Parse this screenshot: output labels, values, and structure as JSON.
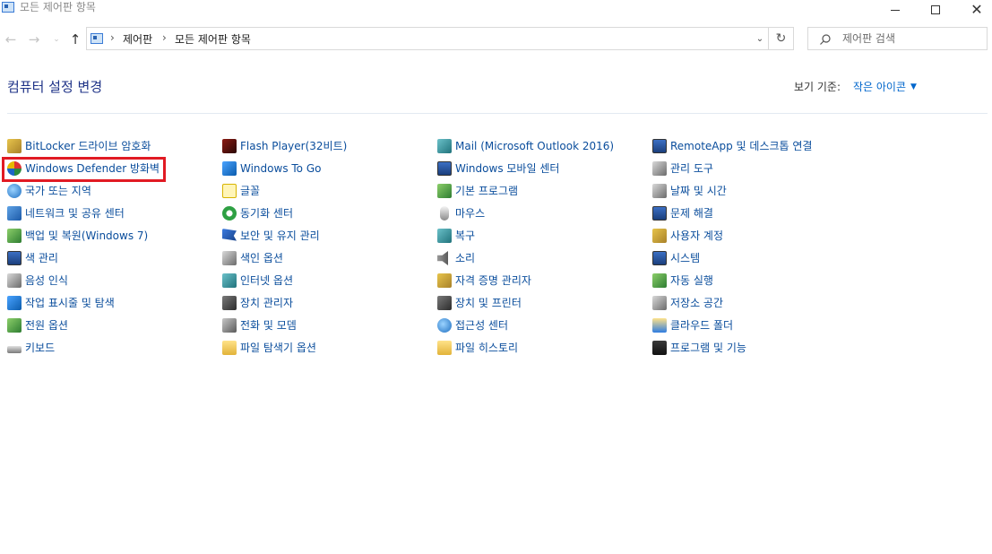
{
  "window": {
    "title": "모든 제어판 항목",
    "minimize_icon": "minimize-icon",
    "maximize_icon": "maximize-icon",
    "close_icon": "close-icon"
  },
  "navigation": {
    "back": "←",
    "forward": "→",
    "recent": "⌄",
    "up": "↑",
    "breadcrumb": [
      "제어판",
      "모든 제어판 항목"
    ],
    "separator": "›",
    "dropdown": "⌄",
    "refresh": "↻"
  },
  "search": {
    "placeholder": "제어판 검색"
  },
  "header": {
    "title": "컴퓨터 설정 변경",
    "view_by_label": "보기 기준:",
    "view_by_value": "작은 아이콘",
    "view_by_arrow": "▼"
  },
  "colors": {
    "title_color": "#1e3287",
    "link_color": "#0a4d9c",
    "accent": "#0066cc",
    "highlight_border": "#e11a23"
  },
  "items": {
    "col1": [
      {
        "label": "BitLocker 드라이브 암호화",
        "icon": "bitlocker-icon"
      },
      {
        "label": "Windows Defender 방화벽",
        "icon": "firewall-icon",
        "highlighted": true
      },
      {
        "label": "국가 또는 지역",
        "icon": "region-icon"
      },
      {
        "label": "네트워크 및 공유 센터",
        "icon": "network-icon"
      },
      {
        "label": "백업 및 복원(Windows 7)",
        "icon": "backup-icon"
      },
      {
        "label": "색 관리",
        "icon": "color-management-icon"
      },
      {
        "label": "음성 인식",
        "icon": "speech-icon"
      },
      {
        "label": "작업 표시줄 및 탐색",
        "icon": "taskbar-icon"
      },
      {
        "label": "전원 옵션",
        "icon": "power-icon"
      },
      {
        "label": "키보드",
        "icon": "keyboard-icon"
      }
    ],
    "col2": [
      {
        "label": "Flash Player(32비트)",
        "icon": "flash-icon"
      },
      {
        "label": "Windows To Go",
        "icon": "windows-to-go-icon"
      },
      {
        "label": "글꼴",
        "icon": "font-icon"
      },
      {
        "label": "동기화 센터",
        "icon": "sync-icon"
      },
      {
        "label": "보안 및 유지 관리",
        "icon": "flag-icon"
      },
      {
        "label": "색인 옵션",
        "icon": "indexing-icon"
      },
      {
        "label": "인터넷 옵션",
        "icon": "internet-options-icon"
      },
      {
        "label": "장치 관리자",
        "icon": "device-manager-icon"
      },
      {
        "label": "전화 및 모뎀",
        "icon": "phone-modem-icon"
      },
      {
        "label": "파일 탐색기 옵션",
        "icon": "folder-options-icon"
      }
    ],
    "col3": [
      {
        "label": "Mail (Microsoft Outlook 2016)",
        "icon": "mail-icon"
      },
      {
        "label": "Windows 모바일 센터",
        "icon": "mobility-icon"
      },
      {
        "label": "기본 프로그램",
        "icon": "default-programs-icon"
      },
      {
        "label": "마우스",
        "icon": "mouse-icon"
      },
      {
        "label": "복구",
        "icon": "recovery-icon"
      },
      {
        "label": "소리",
        "icon": "speaker-icon"
      },
      {
        "label": "자격 증명 관리자",
        "icon": "credential-icon"
      },
      {
        "label": "장치 및 프린터",
        "icon": "printer-icon"
      },
      {
        "label": "접근성 센터",
        "icon": "accessibility-icon"
      },
      {
        "label": "파일 히스토리",
        "icon": "file-history-icon"
      }
    ],
    "col4": [
      {
        "label": "RemoteApp 및 데스크톱 연결",
        "icon": "remoteapp-icon"
      },
      {
        "label": "관리 도구",
        "icon": "admin-tools-icon"
      },
      {
        "label": "날짜 및 시간",
        "icon": "clock-icon"
      },
      {
        "label": "문제 해결",
        "icon": "troubleshoot-icon"
      },
      {
        "label": "사용자 계정",
        "icon": "user-accounts-icon"
      },
      {
        "label": "시스템",
        "icon": "system-icon"
      },
      {
        "label": "자동 실행",
        "icon": "autoplay-icon"
      },
      {
        "label": "저장소 공간",
        "icon": "storage-icon"
      },
      {
        "label": "클라우드 폴더",
        "icon": "cloud-folder-icon"
      },
      {
        "label": "프로그램 및 기능",
        "icon": "programs-icon"
      }
    ]
  }
}
